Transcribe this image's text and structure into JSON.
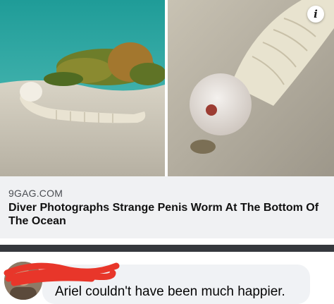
{
  "post": {
    "images": [
      {
        "name": "photo-left-worm-among-seaweed"
      },
      {
        "name": "photo-right-worm-closeup"
      }
    ],
    "info_icon": {
      "glyph": "i",
      "icon": "info-icon"
    }
  },
  "link_preview": {
    "source": "9GAG.COM",
    "headline": "Diver Photographs Strange Penis Worm At The Bottom Of The Ocean"
  },
  "comment": {
    "text": "Ariel couldn't have been much happier."
  },
  "colors": {
    "card_bg": "#f0f1f3",
    "divider": "#35383d",
    "bubble_bg": "#f0f2f5",
    "redaction": "#e8362a"
  }
}
